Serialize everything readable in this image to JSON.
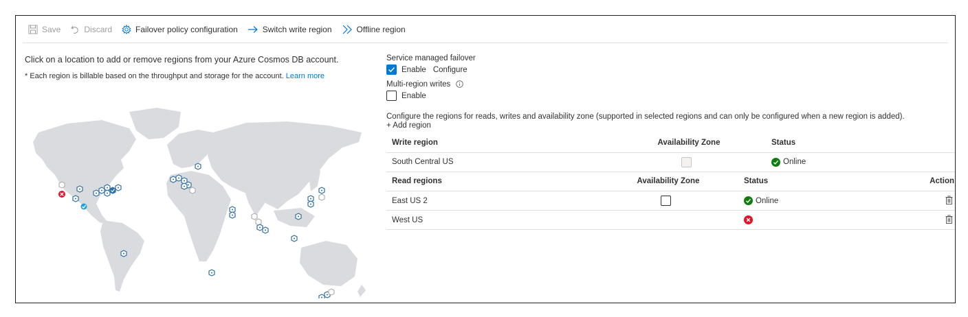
{
  "toolbar": {
    "save": "Save",
    "discard": "Discard",
    "failover": "Failover policy configuration",
    "switch_write": "Switch write region",
    "offline": "Offline region"
  },
  "left": {
    "intro": "Click on a location to add or remove regions from your Azure Cosmos DB account.",
    "billing_note": "* Each region is billable based on the throughput and storage for the account.",
    "learn_more": "Learn more"
  },
  "settings": {
    "service_failover_label": "Service managed failover",
    "service_failover_enable": "Enable",
    "service_failover_enabled": true,
    "configure_link": "Configure",
    "multi_write_label": "Multi-region writes",
    "multi_write_enable": "Enable",
    "multi_write_enabled": false,
    "configure_note": "Configure the regions for reads, writes and availability zone (supported in selected regions and can only be configured when a new region is added).",
    "add_region": "+ Add region"
  },
  "write_table": {
    "headers": [
      "Write region",
      "Availability Zone",
      "Status"
    ],
    "rows": [
      {
        "region": "South Central US",
        "az_checked": false,
        "az_disabled": true,
        "status": "Online",
        "status_type": "online"
      }
    ]
  },
  "read_table": {
    "headers": [
      "Read regions",
      "Availability Zone",
      "Status",
      "Action"
    ],
    "rows": [
      {
        "region": "East US 2",
        "az_checked": false,
        "az_disabled": false,
        "status": "Online",
        "status_type": "online"
      },
      {
        "region": "West US",
        "az_checked": false,
        "az_disabled": false,
        "status": "",
        "status_type": "error",
        "az_hidden": true
      }
    ]
  },
  "colors": {
    "accent": "#0078d4",
    "online": "#107c10",
    "error": "#e81123",
    "map_land": "#d9dbde",
    "region_marker": "#2e6ea6",
    "write_marker": "#1ba1e2"
  }
}
